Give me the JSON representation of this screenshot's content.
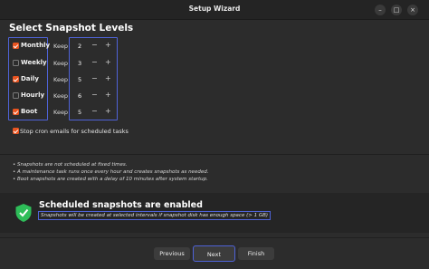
{
  "window": {
    "title": "Setup Wizard",
    "minimize_glyph": "–",
    "maximize_glyph": "□",
    "close_glyph": "×"
  },
  "page": {
    "title": "Select Snapshot Levels"
  },
  "levels": [
    {
      "label": "Monthly",
      "checked": true,
      "keep_label": "Keep",
      "value": "2"
    },
    {
      "label": "Weekly",
      "checked": false,
      "keep_label": "Keep",
      "value": "3"
    },
    {
      "label": "Daily",
      "checked": true,
      "keep_label": "Keep",
      "value": "5"
    },
    {
      "label": "Hourly",
      "checked": false,
      "keep_label": "Keep",
      "value": "6"
    },
    {
      "label": "Boot",
      "checked": true,
      "keep_label": "Keep",
      "value": "5"
    }
  ],
  "spin": {
    "minus": "−",
    "plus": "+"
  },
  "cron": {
    "label": "Stop cron emails for scheduled tasks",
    "checked": true
  },
  "notes": [
    "• Snapshots are not scheduled at fixed times.",
    "• A maintenance task runs once every hour and creates snapshots as needed.",
    "• Boot snapshots are created with a delay of 10 minutes after system startup."
  ],
  "status": {
    "title": "Scheduled snapshots are enabled",
    "subtitle": "Snapshots will be created at selected intervals if snapshot disk has enough space (> 1 GB)",
    "icon": "shield-check-icon",
    "icon_color": "#2ebd59"
  },
  "buttons": {
    "previous": "Previous",
    "next": "Next",
    "finish": "Finish"
  },
  "colors": {
    "accent": "#e95420",
    "focus": "#4f63d8",
    "background": "#2c2c2c"
  }
}
